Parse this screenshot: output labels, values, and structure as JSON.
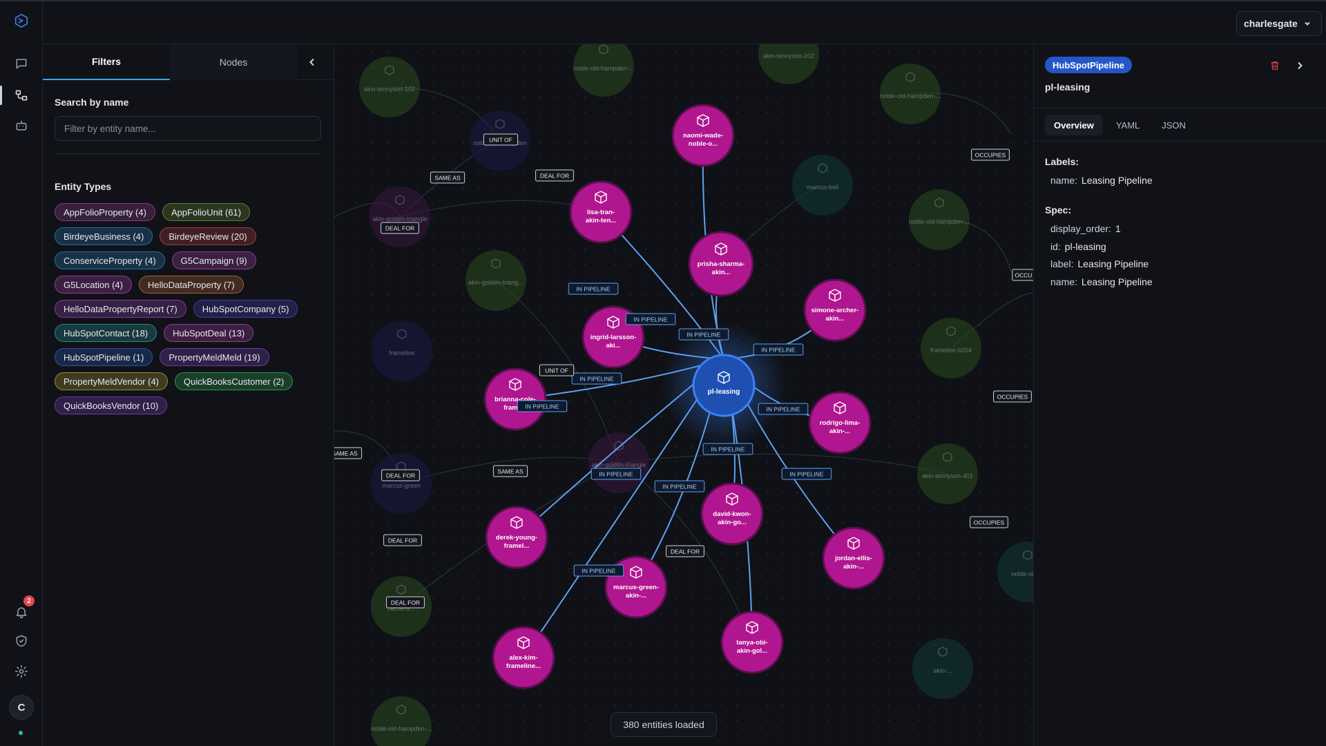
{
  "account": {
    "name": "charlesgate"
  },
  "notifications": {
    "count": "2"
  },
  "user": {
    "initial": "C"
  },
  "panel": {
    "tabs": [
      "Filters",
      "Nodes"
    ],
    "search_label": "Search by name",
    "search_placeholder": "Filter by entity name...",
    "entity_types_label": "Entity Types",
    "chips": [
      {
        "label": "AppFolioProperty (4)",
        "color": "#b04aa6"
      },
      {
        "label": "AppFolioUnit (61)",
        "color": "#7aa23a"
      },
      {
        "label": "BirdeyeBusiness (4)",
        "color": "#2f8fd3"
      },
      {
        "label": "BirdeyeReview (20)",
        "color": "#d24a4a"
      },
      {
        "label": "ConserviceProperty (4)",
        "color": "#2f8fd3"
      },
      {
        "label": "G5Campaign (9)",
        "color": "#c04abf"
      },
      {
        "label": "G5Location (4)",
        "color": "#c04abf"
      },
      {
        "label": "HelloDataProperty (7)",
        "color": "#d4783a"
      },
      {
        "label": "HelloDataPropertyReport (7)",
        "color": "#a84ac4"
      },
      {
        "label": "HubSpotCompany (5)",
        "color": "#5a4ad4"
      },
      {
        "label": "HubSpotContact (18)",
        "color": "#2fb3b3"
      },
      {
        "label": "HubSpotDeal (13)",
        "color": "#c04abf"
      },
      {
        "label": "HubSpotPipeline (1)",
        "color": "#2f6fd3"
      },
      {
        "label": "PropertyMeldMeld (19)",
        "color": "#8a4ad4"
      },
      {
        "label": "PropertyMeldVendor (4)",
        "color": "#c8b83a"
      },
      {
        "label": "QuickBooksCustomer (2)",
        "color": "#3ac45a"
      },
      {
        "label": "QuickBooksVendor (10)",
        "color": "#8a4ad4"
      }
    ]
  },
  "graph": {
    "status": "380 entities loaded",
    "center": {
      "label": "pl-leasing"
    },
    "nodes_active": [
      "naomi-wade-noble-o...",
      "lisa-tran-akin-ten...",
      "prisha-sharma-akin...",
      "simone-archer-akin...",
      "ingrid-larsson-aki...",
      "brianna-cole-frame...",
      "rodrigo-lima-akin-...",
      "david-kwon-akin-go...",
      "derek-young-framel...",
      "marcus-green-akin-...",
      "jordan-ellis-akin-...",
      "tanya-obi-akin-gol...",
      "alex-kim-frameline..."
    ],
    "nodes_faded": [
      "akin-tennyson-102",
      "noble-old-hampden-...",
      "akin-tennyson-202",
      "noble-old-hampden-...",
      "noble-old-hampden",
      "marcus-bell",
      "noble-old-hampden-...",
      "akin-golden-triang...",
      "frameline",
      "noble-old-hampden-...",
      "akin-golden-triangle",
      "frameline-b204",
      "akin-golden-triangle",
      "akin-tennyson-401",
      "marcus-green",
      "rachel-s...",
      "akin-...",
      "noble-old-..."
    ],
    "edge_labels": {
      "in_pipeline": "IN PIPELINE",
      "unit_of": "UNIT OF",
      "same_as": "SAME AS",
      "deal_for": "DEAL FOR",
      "occupies": "OCCUPIES",
      "occu_cut": "OCCU"
    }
  },
  "detail": {
    "type_badge": "HubSpotPipeline",
    "title": "pl-leasing",
    "tabs": [
      "Overview",
      "YAML",
      "JSON"
    ],
    "labels_heading": "Labels:",
    "labels": [
      {
        "key": "name:",
        "value": "Leasing Pipeline"
      }
    ],
    "spec_heading": "Spec:",
    "spec": [
      {
        "key": "display_order:",
        "value": "1"
      },
      {
        "key": "id:",
        "value": "pl-leasing"
      },
      {
        "key": "label:",
        "value": "Leasing Pipeline"
      },
      {
        "key": "name:",
        "value": "Leasing Pipeline"
      }
    ]
  },
  "colors": {
    "accent": "#3aa6e0",
    "node_active": "#b0168f",
    "node_center": "#1f4fb0",
    "edge_active": "#5ea3f0",
    "danger": "#e5484d"
  }
}
